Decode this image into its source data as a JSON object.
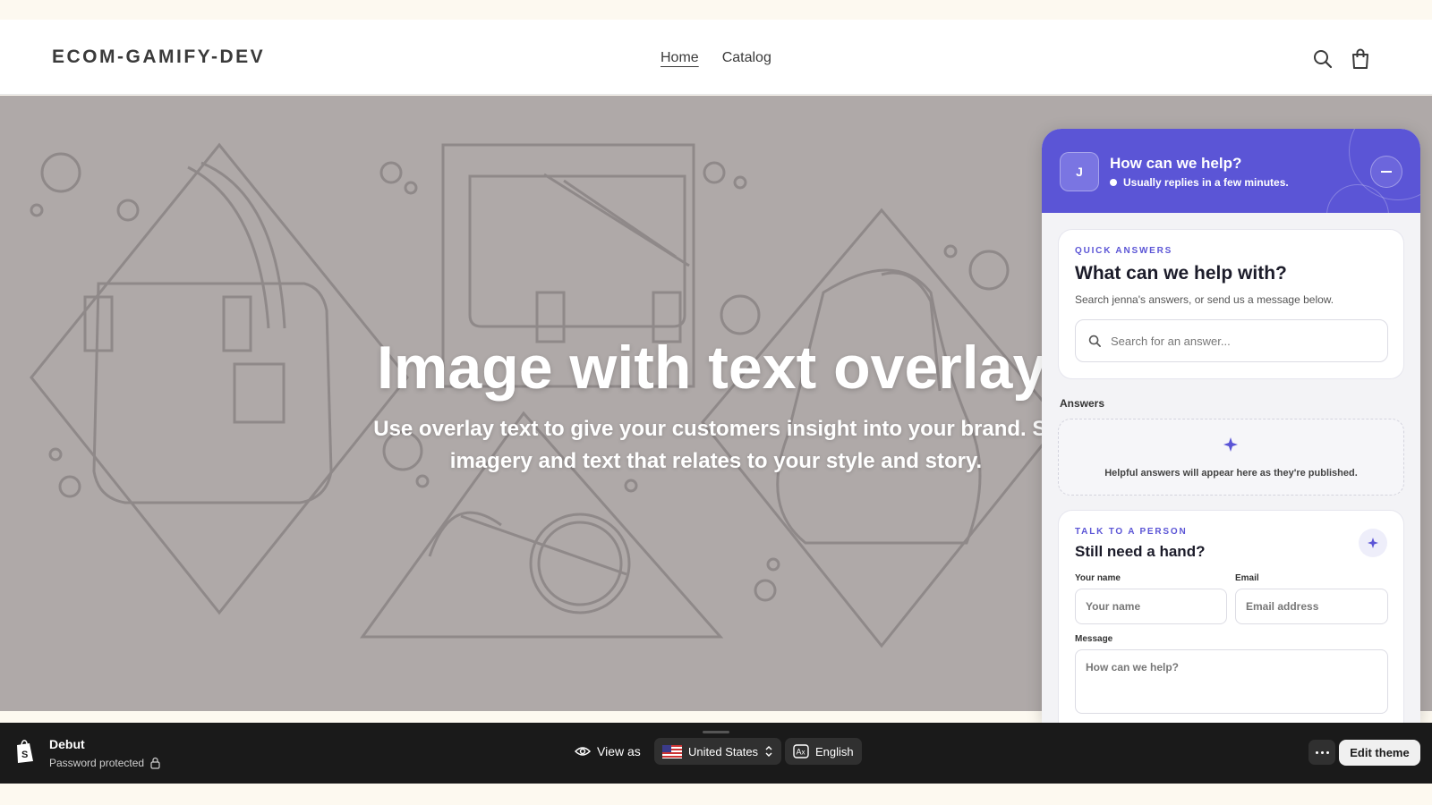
{
  "store": {
    "logo": "ECOM-GAMIFY-DEV",
    "nav": [
      {
        "label": "Home",
        "active": true
      },
      {
        "label": "Catalog",
        "active": false
      }
    ],
    "icons": [
      "search-icon",
      "cart-icon"
    ]
  },
  "hero": {
    "title": "Image with text overlay",
    "subtitle_line1": "Use overlay text to give your customers insight into your brand. Se",
    "subtitle_line2": "imagery and text that relates to your style and story.",
    "background_color": "#afa9a8"
  },
  "chat": {
    "avatar_initial": "J",
    "title": "How can we help?",
    "status": "Usually replies in a few minutes.",
    "accent_color": "#5b55d6",
    "quick_answers": {
      "eyebrow": "QUICK ANSWERS",
      "title": "What can we help with?",
      "description": "Search jenna's answers, or send us a message below.",
      "search_placeholder": "Search for an answer..."
    },
    "answers": {
      "label": "Answers",
      "empty_text": "Helpful answers will appear here as they're published."
    },
    "talk": {
      "eyebrow": "TALK TO A PERSON",
      "title": "Still need a hand?",
      "name_label": "Your name",
      "name_placeholder": "Your name",
      "email_label": "Email",
      "email_placeholder": "Email address",
      "message_label": "Message",
      "message_placeholder": "How can we help?"
    }
  },
  "preview_bar": {
    "theme_name": "Debut",
    "theme_status": "Password protected",
    "view_as": "View as",
    "country": "United States",
    "language": "English",
    "edit_button": "Edit theme"
  }
}
